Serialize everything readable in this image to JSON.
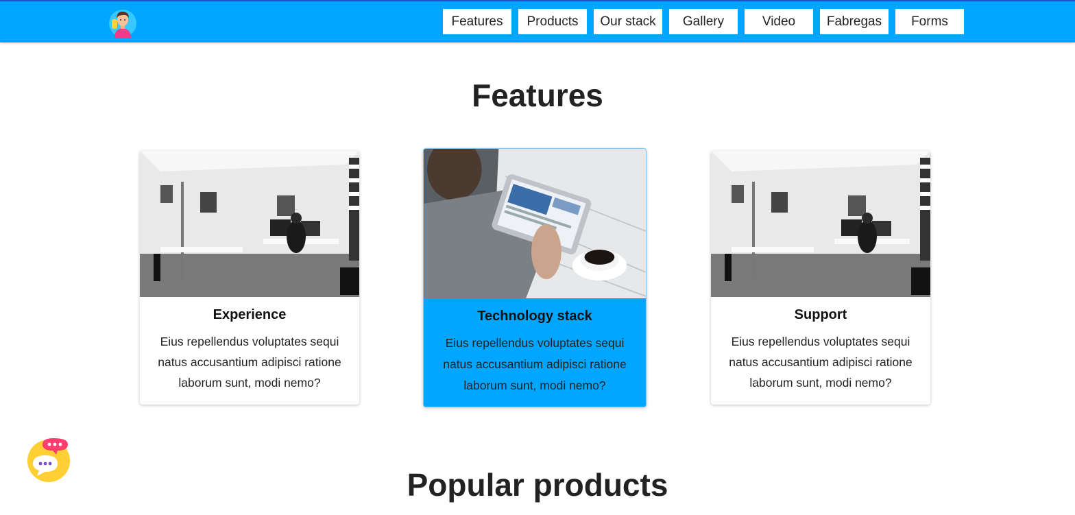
{
  "navbar": {
    "logo_icon": "avatar-logo-icon",
    "items": [
      {
        "label": "Features"
      },
      {
        "label": "Products"
      },
      {
        "label": "Our stack"
      },
      {
        "label": "Gallery"
      },
      {
        "label": "Video"
      },
      {
        "label": "Fabregas"
      },
      {
        "label": "Forms"
      }
    ],
    "background_color": "#00a6ff"
  },
  "features": {
    "title": "Features",
    "cards": [
      {
        "title": "Experience",
        "text": "Eius repellendus voluptates sequi natus accusantium adipisci ratione laborum sunt, modi nemo?",
        "image": "office-photo"
      },
      {
        "title": "Technology stack",
        "text": "Eius repellendus voluptates sequi natus accusantium adipisci ratione laborum sunt, modi nemo?",
        "image": "tablet-coffee-photo",
        "highlighted": true
      },
      {
        "title": "Support",
        "text": "Eius repellendus voluptates sequi natus accusantium adipisci ratione laborum sunt, modi nemo?",
        "image": "office-photo"
      }
    ]
  },
  "popular_products": {
    "title": "Popular products"
  },
  "chat_widget": {
    "icon": "chat-bubbles-icon"
  },
  "colors": {
    "accent": "#00a6ff",
    "top_border": "#1f55c9"
  }
}
